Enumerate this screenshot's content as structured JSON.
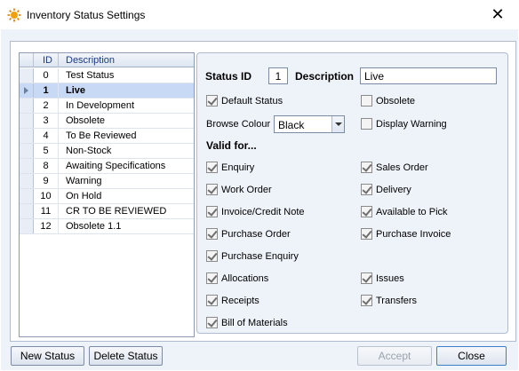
{
  "window": {
    "title": "Inventory Status Settings",
    "close_glyph": "✕",
    "icon": "gear-sun-icon",
    "icon_color": "#f2a10c"
  },
  "grid": {
    "columns": [
      "ID",
      "Description"
    ],
    "rows": [
      {
        "id": "0",
        "description": "Test Status",
        "selected": false
      },
      {
        "id": "1",
        "description": "Live",
        "selected": true
      },
      {
        "id": "2",
        "description": "In Development",
        "selected": false
      },
      {
        "id": "3",
        "description": "Obsolete",
        "selected": false
      },
      {
        "id": "4",
        "description": "To Be Reviewed",
        "selected": false
      },
      {
        "id": "5",
        "description": "Non-Stock",
        "selected": false
      },
      {
        "id": "8",
        "description": "Awaiting Specifications",
        "selected": false
      },
      {
        "id": "9",
        "description": "Warning",
        "selected": false
      },
      {
        "id": "10",
        "description": "On Hold",
        "selected": false
      },
      {
        "id": "11",
        "description": "CR TO BE REVIEWED",
        "selected": false
      },
      {
        "id": "12",
        "description": "Obsolete 1.1",
        "selected": false
      }
    ]
  },
  "details": {
    "status_id_label": "Status ID",
    "status_id_value": "1",
    "description_label": "Description",
    "description_value": "Live",
    "default_status_label": "Default Status",
    "default_status_checked": true,
    "obsolete_label": "Obsolete",
    "obsolete_checked": false,
    "browse_colour_label": "Browse Colour",
    "browse_colour_value": "Black",
    "display_warning_label": "Display Warning",
    "display_warning_checked": false,
    "valid_for_label": "Valid for...",
    "valid_for": {
      "enquiry": {
        "label": "Enquiry",
        "checked": true
      },
      "sales_order": {
        "label": "Sales Order",
        "checked": true
      },
      "work_order": {
        "label": "Work Order",
        "checked": true
      },
      "delivery": {
        "label": "Delivery",
        "checked": true
      },
      "invoice_credit_note": {
        "label": "Invoice/Credit Note",
        "checked": true
      },
      "available_to_pick": {
        "label": "Available to Pick",
        "checked": true
      },
      "purchase_order": {
        "label": "Purchase Order",
        "checked": true
      },
      "purchase_invoice": {
        "label": "Purchase Invoice",
        "checked": true
      },
      "purchase_enquiry": {
        "label": "Purchase Enquiry",
        "checked": true
      },
      "allocations": {
        "label": "Allocations",
        "checked": true
      },
      "issues": {
        "label": "Issues",
        "checked": true
      },
      "receipts": {
        "label": "Receipts",
        "checked": true
      },
      "transfers": {
        "label": "Transfers",
        "checked": true
      },
      "bill_of_materials": {
        "label": "Bill of Materials",
        "checked": true
      }
    }
  },
  "buttons": {
    "new_status": "New Status",
    "delete_status": "Delete Status",
    "accept": "Accept",
    "close": "Close"
  }
}
